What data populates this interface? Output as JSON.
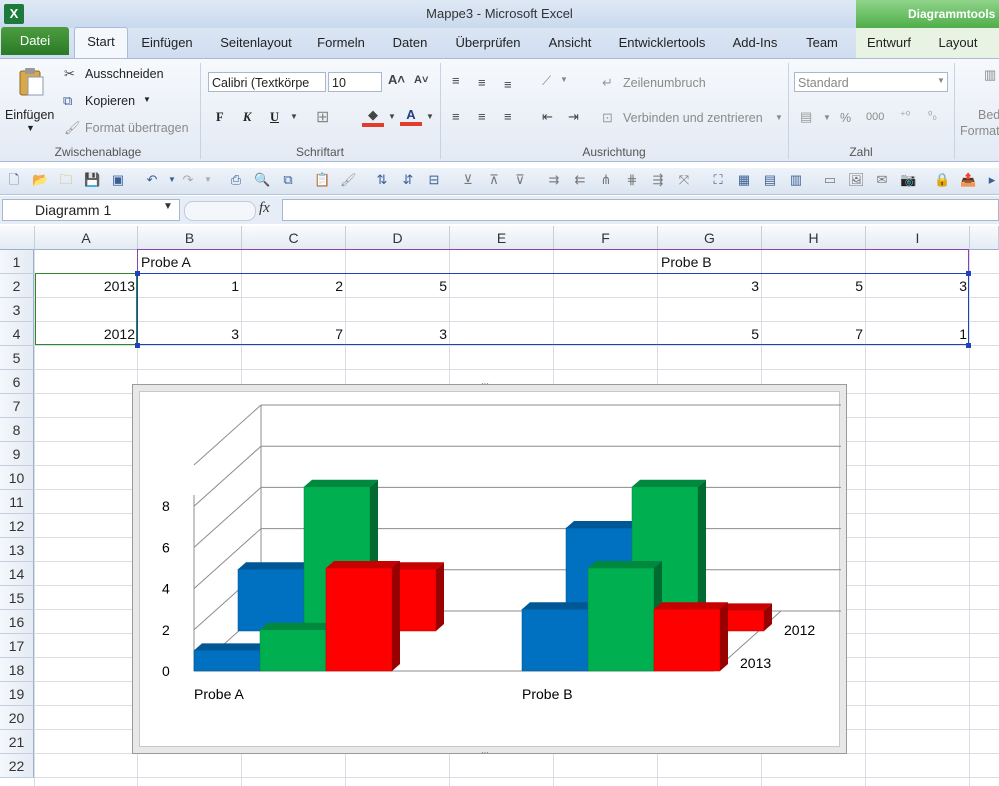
{
  "window": {
    "title": "Mappe3  -  Microsoft Excel",
    "context_tools": "Diagrammtools"
  },
  "tabs": {
    "datei": "Datei",
    "start": "Start",
    "einfuegen": "Einfügen",
    "seitenlayout": "Seitenlayout",
    "formeln": "Formeln",
    "daten": "Daten",
    "ueberpruefen": "Überprüfen",
    "ansicht": "Ansicht",
    "entwicklertools": "Entwicklertools",
    "addins": "Add-Ins",
    "team": "Team",
    "entwurf": "Entwurf",
    "layout": "Layout"
  },
  "ribbon": {
    "clipboard": {
      "paste": "Einfügen",
      "cut": "Ausschneiden",
      "copy": "Kopieren",
      "format_painter": "Format übertragen",
      "group": "Zwischenablage"
    },
    "font": {
      "name": "Calibri (Textkörpe",
      "size": "10",
      "bold": "F",
      "italic": "K",
      "underline": "U",
      "group": "Schriftart"
    },
    "alignment": {
      "wrap": "Zeilenumbruch",
      "merge": "Verbinden und zentrieren",
      "group": "Ausrichtung"
    },
    "number": {
      "format": "Standard",
      "percent": "%",
      "thousands": "000",
      "group": "Zahl"
    },
    "styles": {
      "conditional": "Bedi",
      "format": "Formati"
    }
  },
  "formula_bar": {
    "name_box": "Diagramm 1",
    "fx": "fx",
    "formula": ""
  },
  "sheet": {
    "columns": [
      "A",
      "B",
      "C",
      "D",
      "E",
      "F",
      "G",
      "H",
      "I"
    ],
    "rows": [
      "1",
      "2",
      "3",
      "4",
      "5",
      "6",
      "7",
      "8",
      "9",
      "10",
      "11",
      "12",
      "13",
      "14",
      "15",
      "16",
      "17",
      "18",
      "19",
      "20",
      "21",
      "22"
    ],
    "cells": {
      "B1": "Probe A",
      "G1": "Probe B",
      "A2": "2013",
      "B2": "1",
      "C2": "2",
      "D2": "5",
      "G2": "3",
      "H2": "5",
      "I2": "3",
      "A4": "2012",
      "B4": "3",
      "C4": "7",
      "D4": "3",
      "G4": "5",
      "H4": "7",
      "I4": "1"
    }
  },
  "colors": {
    "blue": "#0070C0",
    "green": "#00B050",
    "red": "#FF0000"
  },
  "chart_data": {
    "type": "bar",
    "subtype": "3d-column",
    "categories": [
      "Probe A",
      "Probe B"
    ],
    "series_depth": [
      "2013",
      "2012"
    ],
    "y_ticks": [
      "0",
      "2",
      "4",
      "6",
      "8"
    ],
    "ylim": [
      0,
      8
    ],
    "grid": true,
    "legend": "none",
    "depth_series": [
      {
        "name": "2013",
        "values": [
          [
            1,
            2,
            5
          ],
          [
            3,
            5,
            3
          ]
        ]
      },
      {
        "name": "2012",
        "values": [
          [
            3,
            7,
            3
          ],
          [
            5,
            7,
            1
          ]
        ]
      }
    ],
    "bar_colors": [
      "#0070C0",
      "#00B050",
      "#FF0000"
    ]
  }
}
